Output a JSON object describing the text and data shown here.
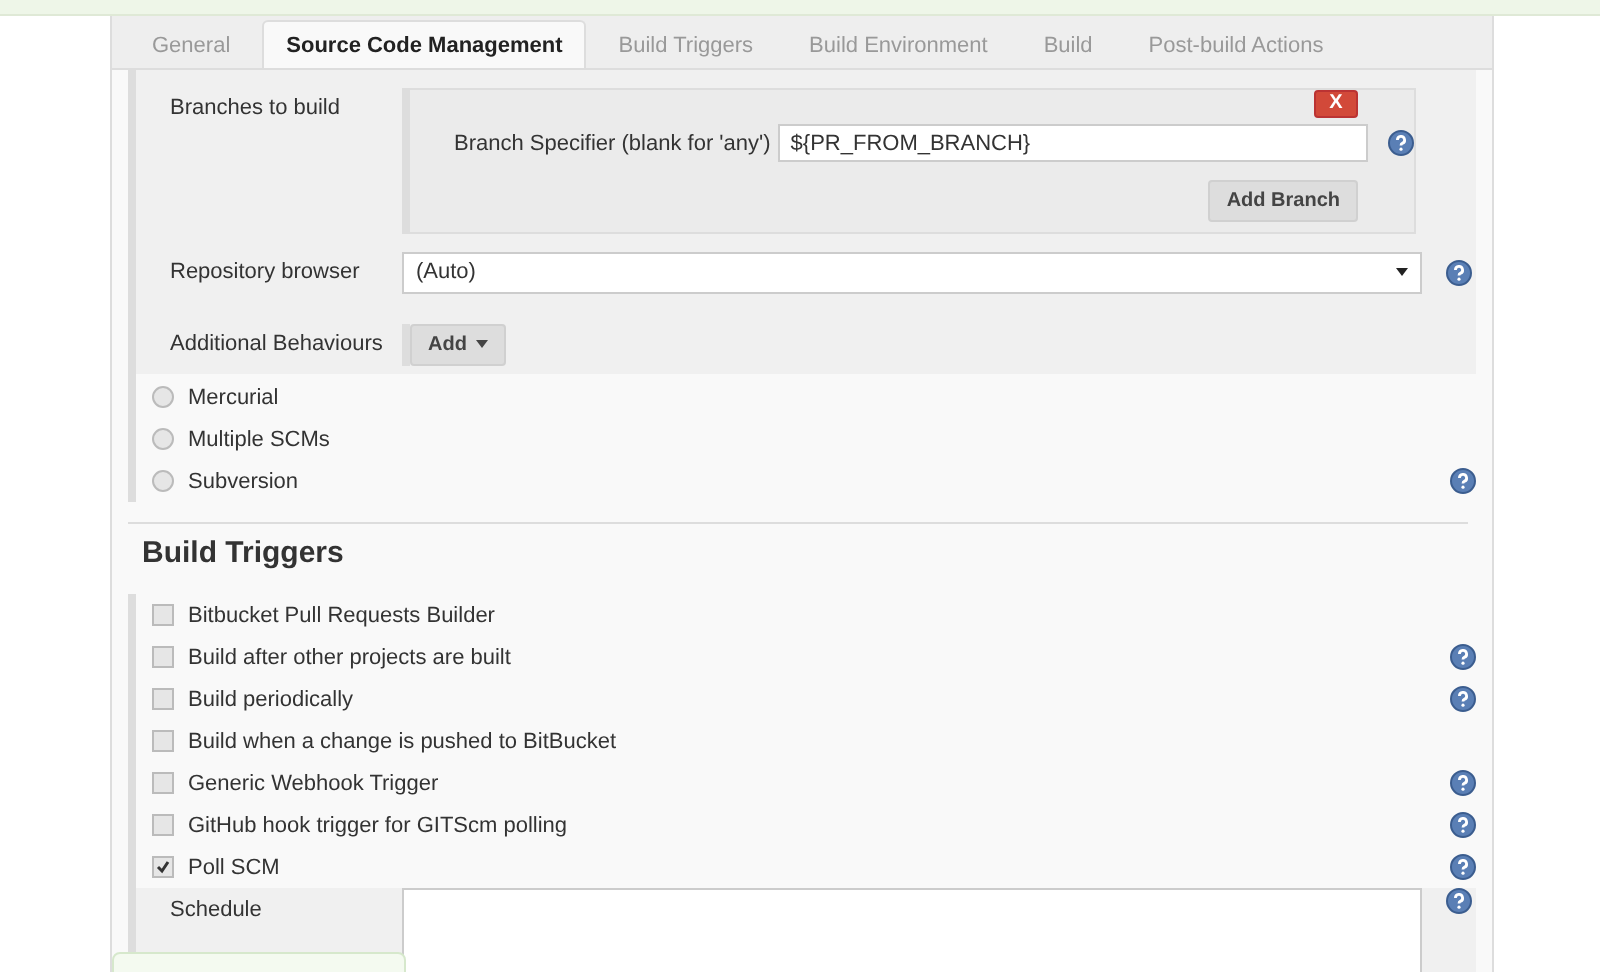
{
  "tabs": [
    {
      "label": "General",
      "selected": false
    },
    {
      "label": "Source Code Management",
      "selected": true
    },
    {
      "label": "Build Triggers",
      "selected": false
    },
    {
      "label": "Build Environment",
      "selected": false
    },
    {
      "label": "Build",
      "selected": false
    },
    {
      "label": "Post-build Actions",
      "selected": false
    }
  ],
  "git": {
    "branches_label": "Branches to build",
    "delete_button": "X",
    "specifier_label": "Branch Specifier (blank for 'any')",
    "specifier_value": "${PR_FROM_BRANCH}",
    "add_branch_button": "Add Branch",
    "repository_browser_label": "Repository browser",
    "repository_browser_value": "(Auto)",
    "behaviours_label": "Additional Behaviours",
    "add_button": "Add"
  },
  "scm_options": [
    {
      "label": "Mercurial",
      "selected": false,
      "help": false
    },
    {
      "label": "Multiple SCMs",
      "selected": false,
      "help": false
    },
    {
      "label": "Subversion",
      "selected": false,
      "help": true
    }
  ],
  "build_triggers": {
    "title": "Build Triggers",
    "items": [
      {
        "label": "Bitbucket Pull Requests Builder",
        "checked": false,
        "help": false
      },
      {
        "label": "Build after other projects are built",
        "checked": false,
        "help": true
      },
      {
        "label": "Build periodically",
        "checked": false,
        "help": true
      },
      {
        "label": "Build when a change is pushed to BitBucket",
        "checked": false,
        "help": false
      },
      {
        "label": "Generic Webhook Trigger",
        "checked": false,
        "help": true
      },
      {
        "label": "GitHub hook trigger for GITScm polling",
        "checked": false,
        "help": true
      },
      {
        "label": "Poll SCM",
        "checked": true,
        "help": true
      }
    ],
    "schedule_label": "Schedule"
  }
}
